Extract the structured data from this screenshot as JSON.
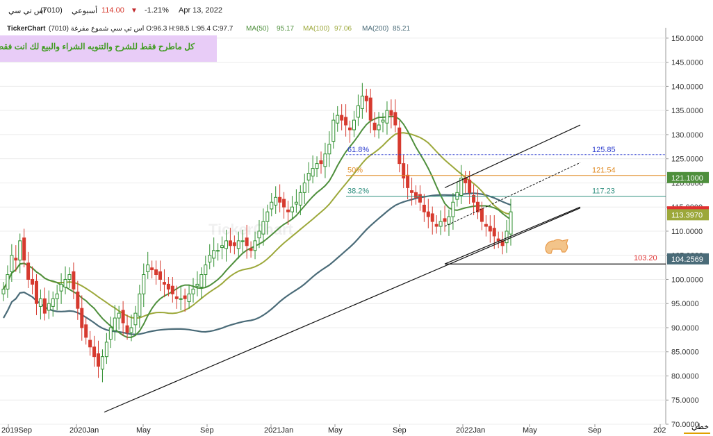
{
  "header": {
    "symbol_name": "اس تي سي",
    "symbol_code": "(7010)",
    "period": "أسبوعي",
    "price": "114.00",
    "change": "-1.21%",
    "date": "Apr 13, 2022"
  },
  "subheader": {
    "brand": "TickerChart",
    "ohlc": "اس تي سي شموع مفرغة (7010) O:96.3 H:98.5 L:95.4 C:97.7",
    "ma50_label": "MA(50)",
    "ma50_value": "95.17",
    "ma100_label": "MA(100)",
    "ma100_value": "97.06",
    "ma200_label": "MA(200)",
    "ma200_value": "85.21"
  },
  "note": "كل ماطرح فقط للشرح   والتنويه الشراء والبيع لك انت فقط",
  "watermark": "TickerChart",
  "scale_mode": "خطي",
  "colors": {
    "up": "#2f8f2f",
    "down": "#d63a2f",
    "ma50": "#4e8f3c",
    "ma100": "#9ca83a",
    "ma200": "#4a6b78",
    "fib618": "#2f3fcf",
    "fib50": "#e08b23",
    "fib382": "#2f8f7f",
    "support": "#111111",
    "price_tag": "#e03030"
  },
  "chart_data": {
    "type": "candlestick",
    "x_labels": [
      "2019Sep",
      "2020Jan",
      "May",
      "Sep",
      "2021Jan",
      "May",
      "Sep",
      "2022Jan",
      "May",
      "Sep",
      "202"
    ],
    "y_ticks": [
      "70.0000",
      "75.0000",
      "80.0000",
      "85.0000",
      "90.0000",
      "95.0000",
      "100.0000",
      "105.0000",
      "110.0000",
      "115.0000",
      "120.0000",
      "125.0000",
      "130.0000",
      "135.0000",
      "140.0000",
      "145.0000",
      "150.0000"
    ],
    "ylim": [
      70,
      152
    ],
    "closes": [
      98,
      101,
      105,
      104,
      108,
      104,
      100,
      99,
      95,
      96,
      93,
      95,
      96,
      97,
      99,
      100,
      101,
      98,
      94,
      90,
      88,
      86,
      84,
      82,
      84,
      87,
      90,
      92,
      93,
      91,
      89,
      90,
      93,
      97,
      101,
      103,
      102,
      101,
      100,
      99,
      98,
      97,
      96,
      96,
      96,
      97,
      98,
      99,
      101,
      103,
      105,
      106,
      106,
      107,
      108,
      107,
      107,
      108,
      108,
      107,
      106,
      108,
      110,
      112,
      114,
      116,
      117,
      116,
      115,
      114,
      115,
      116,
      118,
      120,
      122,
      123,
      124,
      124,
      126,
      128,
      133,
      134,
      133,
      132,
      131,
      133,
      136,
      138,
      137,
      133,
      131,
      132,
      133,
      135,
      134,
      132,
      124,
      121,
      119,
      118,
      117,
      116,
      114,
      113,
      112,
      111,
      112,
      112,
      113,
      116,
      118,
      121,
      120,
      118,
      116,
      114,
      112,
      111,
      110,
      109,
      108,
      107,
      110,
      114
    ],
    "fib_levels": [
      {
        "label": "61.8%",
        "value": "125.85"
      },
      {
        "label": "50%",
        "value": "121.54"
      },
      {
        "label": "38.2%",
        "value": "117.23"
      }
    ],
    "support_level": "103.20",
    "ma_tags": {
      "ma50": "121.1000",
      "ma100": "113.3970",
      "ma200": "104.2569"
    },
    "last_price_tag": "114.0000"
  }
}
